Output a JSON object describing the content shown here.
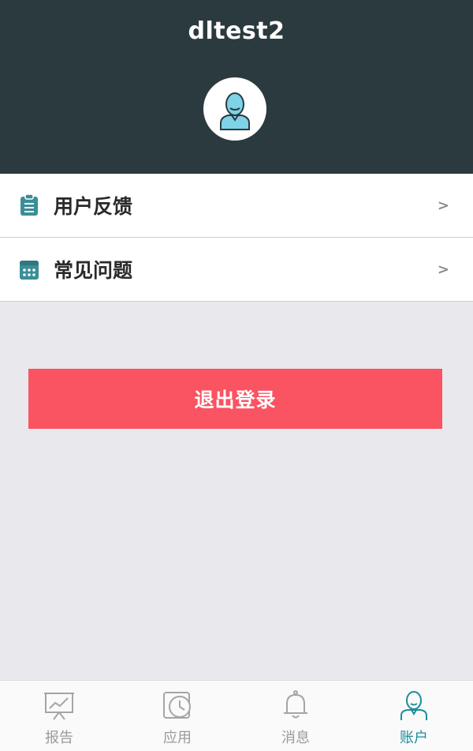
{
  "header": {
    "username": "dltest2",
    "avatar_icon": "user-avatar-icon"
  },
  "menu": [
    {
      "label": "用户反馈",
      "icon": "clipboard-icon",
      "chevron": ">"
    },
    {
      "label": "常见问题",
      "icon": "calendar-grid-icon",
      "chevron": ">"
    }
  ],
  "logout": {
    "label": "退出登录"
  },
  "tabs": [
    {
      "label": "报告",
      "icon": "report-chart-icon",
      "active": false
    },
    {
      "label": "应用",
      "icon": "clock-app-icon",
      "active": false
    },
    {
      "label": "消息",
      "icon": "bell-icon",
      "active": false
    },
    {
      "label": "账户",
      "icon": "user-icon",
      "active": true
    }
  ],
  "colors": {
    "header_bg": "#2b3a3f",
    "accent": "#1c8d9a",
    "logout_bg": "#fa5361",
    "page_bg": "#e8e8ed"
  }
}
